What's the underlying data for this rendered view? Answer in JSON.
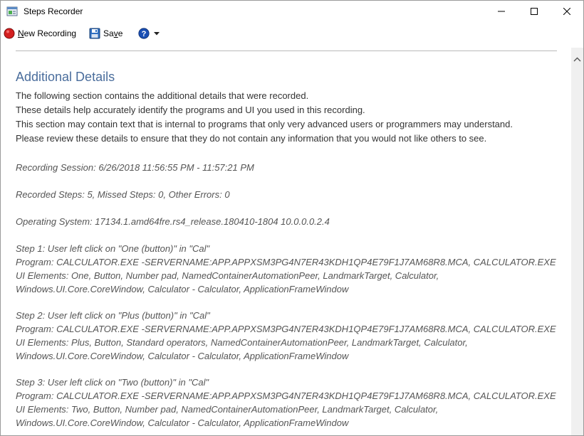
{
  "window": {
    "title": "Steps Recorder"
  },
  "toolbar": {
    "new_recording_prefix": "N",
    "new_recording_rest": "ew Recording",
    "save_prefix": "Sa",
    "save_underline": "v",
    "save_rest": "e"
  },
  "doc": {
    "title": "Additional Details",
    "intro": [
      "The following section contains the additional details that were recorded.",
      "These details help accurately identify the programs and UI you used in this recording.",
      "This section may contain text that is internal to programs that only very advanced users or programmers may understand.",
      "Please review these details to ensure that they do not contain any information that you would not like others to see."
    ],
    "session": "Recording Session: 6/26/2018 11:56:55 PM - 11:57:21 PM",
    "summary": "Recorded Steps: 5, Missed Steps: 0, Other Errors: 0",
    "os": "Operating System: 17134.1.amd64fre.rs4_release.180410-1804 10.0.0.0.2.4",
    "steps": [
      {
        "header": "Step 1: User left click on \"One (button)\" in \"Cal\"",
        "program": "Program: CALCULATOR.EXE -SERVERNAME:APP.APPXSM3PG4N7ER43KDH1QP4E79F1J7AM68R8.MCA, CALCULATOR.EXE",
        "elements1": "UI Elements: One, Button, Number pad, NamedContainerAutomationPeer, LandmarkTarget, Calculator,",
        "elements2": "Windows.UI.Core.CoreWindow, Calculator - Calculator, ApplicationFrameWindow"
      },
      {
        "header": "Step 2: User left click on \"Plus (button)\" in \"Cal\"",
        "program": "Program: CALCULATOR.EXE -SERVERNAME:APP.APPXSM3PG4N7ER43KDH1QP4E79F1J7AM68R8.MCA, CALCULATOR.EXE",
        "elements1": "UI Elements: Plus, Button, Standard operators, NamedContainerAutomationPeer, LandmarkTarget, Calculator,",
        "elements2": "Windows.UI.Core.CoreWindow, Calculator - Calculator, ApplicationFrameWindow"
      },
      {
        "header": "Step 3: User left click on \"Two (button)\" in \"Cal\"",
        "program": "Program: CALCULATOR.EXE -SERVERNAME:APP.APPXSM3PG4N7ER43KDH1QP4E79F1J7AM68R8.MCA, CALCULATOR.EXE",
        "elements1": "UI Elements: Two, Button, Number pad, NamedContainerAutomationPeer, LandmarkTarget, Calculator,",
        "elements2": "Windows.UI.Core.CoreWindow, Calculator - Calculator, ApplicationFrameWindow"
      }
    ]
  },
  "colors": {
    "accent_title": "#4a6d9c",
    "record_red": "#d42020",
    "help_blue": "#1a4fb4"
  },
  "icons": {
    "app": "steps-recorder-app-icon",
    "record": "record-icon",
    "save": "floppy-disk-icon",
    "help": "help-icon",
    "dropdown": "chevron-down-icon",
    "scroll_up": "chevron-up-icon"
  }
}
